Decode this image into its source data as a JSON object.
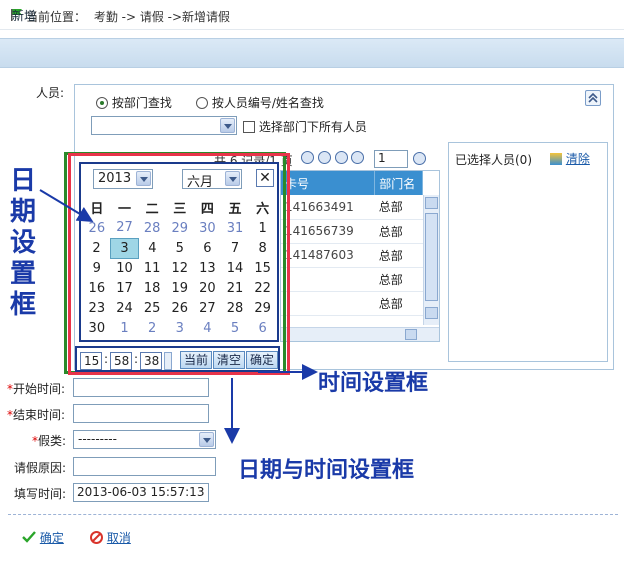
{
  "breadcrumb": {
    "label": "当前位置：",
    "path": "考勤 -> 请假 ->新增请假"
  },
  "header": {
    "title": "新增"
  },
  "form": {
    "person_label": "人员:",
    "search_by_dept": "按部门查找",
    "search_by_id": "按人员编号/姓名查找",
    "select_all_label": "选择部门下所有人员",
    "pager_text": "共 6 记录/1 页",
    "page_value": "1",
    "selected_label": "已选择人员(0)",
    "clear_label": "清除",
    "columns": [
      "卡号",
      "部门名"
    ],
    "rows": [
      [
        "141663491",
        "总部"
      ],
      [
        "141656739",
        "总部"
      ],
      [
        "141487603",
        "总部"
      ],
      [
        "",
        "总部"
      ],
      [
        "",
        "总部"
      ]
    ],
    "start_label": "开始时间:",
    "end_label": "结束时间:",
    "type_label": "假类:",
    "type_value": "---------",
    "reason_label": "请假原因:",
    "fill_label": "填写时间:",
    "fill_value": "2013-06-03 15:57:13"
  },
  "calendar": {
    "year": "2013",
    "month": "六月",
    "weekdays": [
      "日",
      "一",
      "二",
      "三",
      "四",
      "五",
      "六"
    ],
    "weeks": [
      [
        "26",
        "27",
        "28",
        "29",
        "30",
        "31",
        "1"
      ],
      [
        "2",
        "3",
        "4",
        "5",
        "6",
        "7",
        "8"
      ],
      [
        "9",
        "10",
        "11",
        "12",
        "13",
        "14",
        "15"
      ],
      [
        "16",
        "17",
        "18",
        "19",
        "20",
        "21",
        "22"
      ],
      [
        "23",
        "24",
        "25",
        "26",
        "27",
        "28",
        "29"
      ],
      [
        "30",
        "1",
        "2",
        "3",
        "4",
        "5",
        "6"
      ]
    ],
    "hour": "15",
    "minute": "58",
    "second": "38",
    "now_btn": "当前",
    "clear_btn": "清空",
    "ok_btn": "确定"
  },
  "annotations": {
    "date_box": [
      "日",
      "期",
      "设",
      "置",
      "框"
    ],
    "time_box": "时间设置框",
    "datetime_box": "日期与时间设置框"
  },
  "actions": {
    "ok": "确定",
    "cancel": "取消"
  },
  "colors": {
    "header_bg": "#c8dcee",
    "grid_header": "#3a8fd0",
    "annotation": "#1a3aa8",
    "today_bg": "#9fd6e6"
  }
}
